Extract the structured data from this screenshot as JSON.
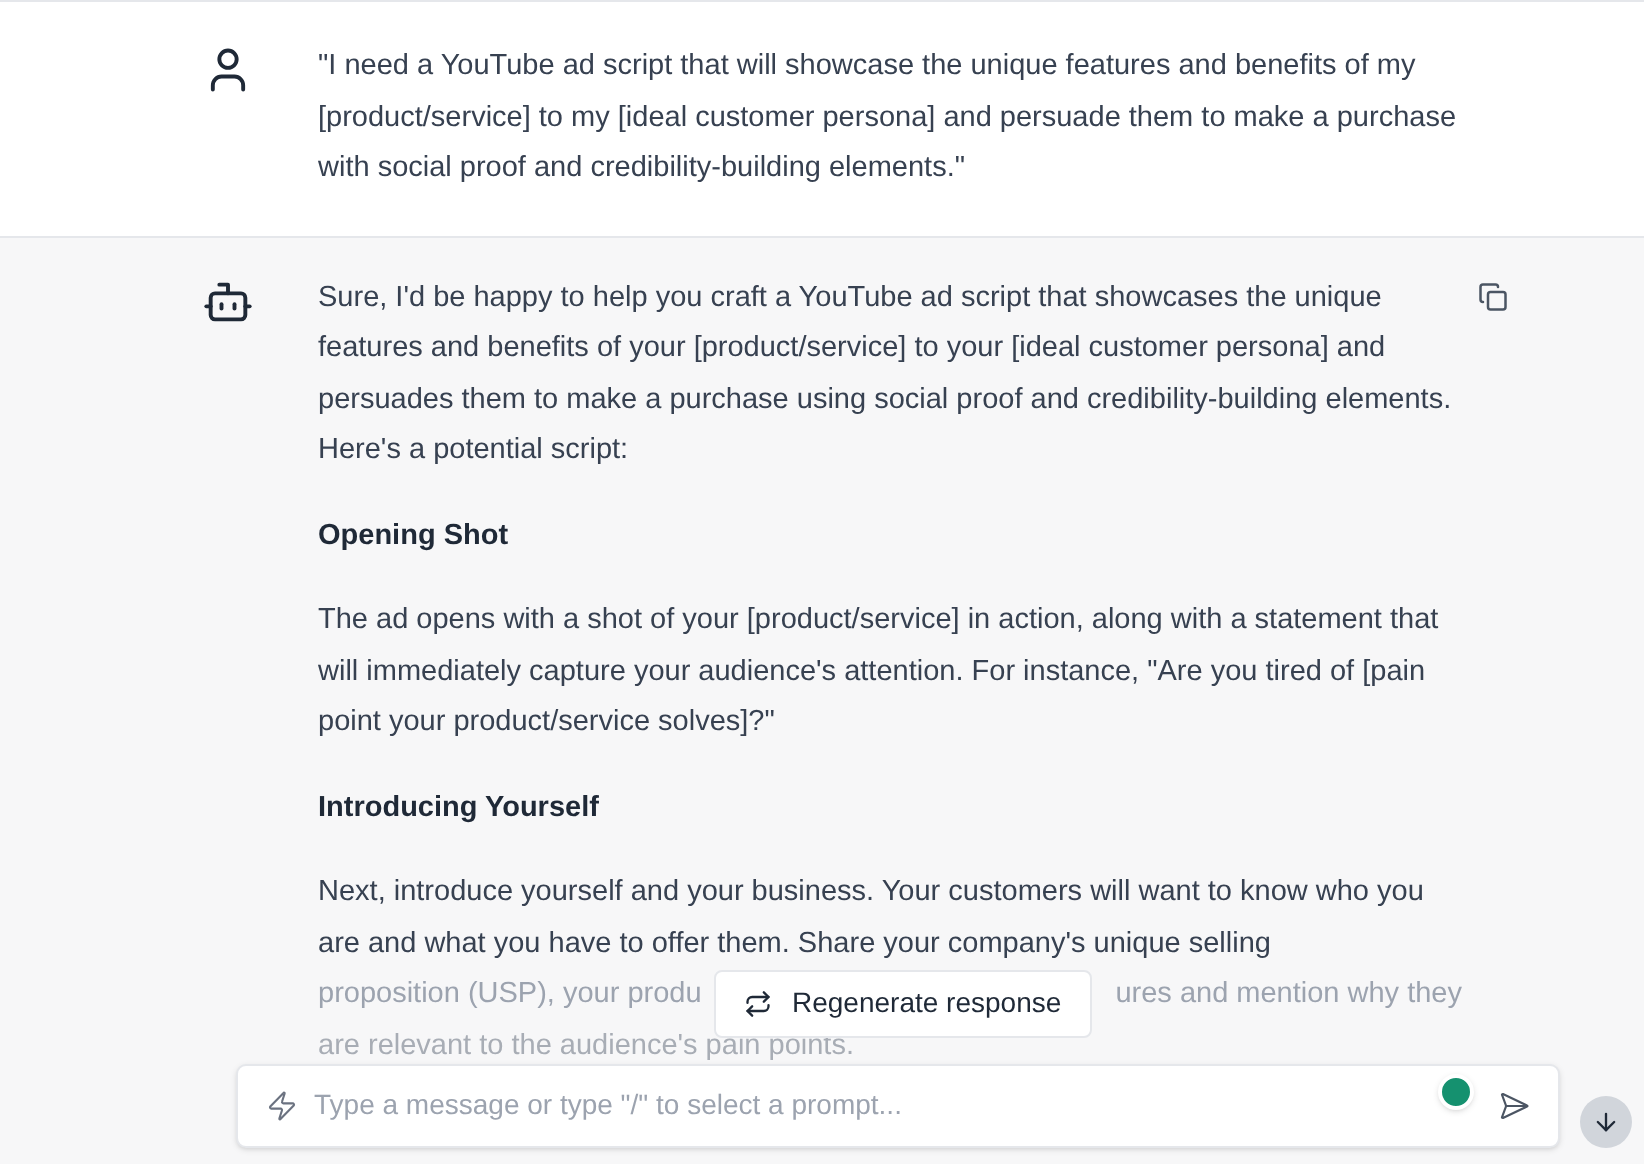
{
  "user_message": {
    "text": "\"I need a YouTube ad script that will showcase the unique features and benefits of my [product/service] to my [ideal customer persona] and persuade them to make a purchase with social proof and credibility-building elements.\""
  },
  "bot_message": {
    "blocks": [
      {
        "kind": "paragraph",
        "text": "Sure, I'd be happy to help you craft a YouTube ad script that showcases the unique features and benefits of your [product/service] to your [ideal customer persona] and persuades them to make a purchase using social proof and credibility-building elements. Here's a potential script:"
      },
      {
        "kind": "heading",
        "text": "Opening Shot"
      },
      {
        "kind": "paragraph",
        "text": "The ad opens with a shot of your [product/service] in action, along with a statement that will immediately capture your audience's attention. For instance, \"Are you tired of [pain point your product/service solves]?\""
      },
      {
        "kind": "heading",
        "text": "Introducing Yourself"
      },
      {
        "kind": "paragraph",
        "text": "Next, introduce yourself and your business. Your customers will want to know who you are and what you have to offer them. Share your company's unique selling"
      },
      {
        "kind": "covered_line",
        "parts": [
          "proposition (USP), your produ",
          "ures and mention why they"
        ]
      },
      {
        "kind": "faded_line",
        "text": "are relevant to the audience's pain points."
      }
    ]
  },
  "regenerate_button": {
    "label": "Regenerate response"
  },
  "composer": {
    "placeholder": "Type a message or type \"/\" to select a prompt..."
  }
}
